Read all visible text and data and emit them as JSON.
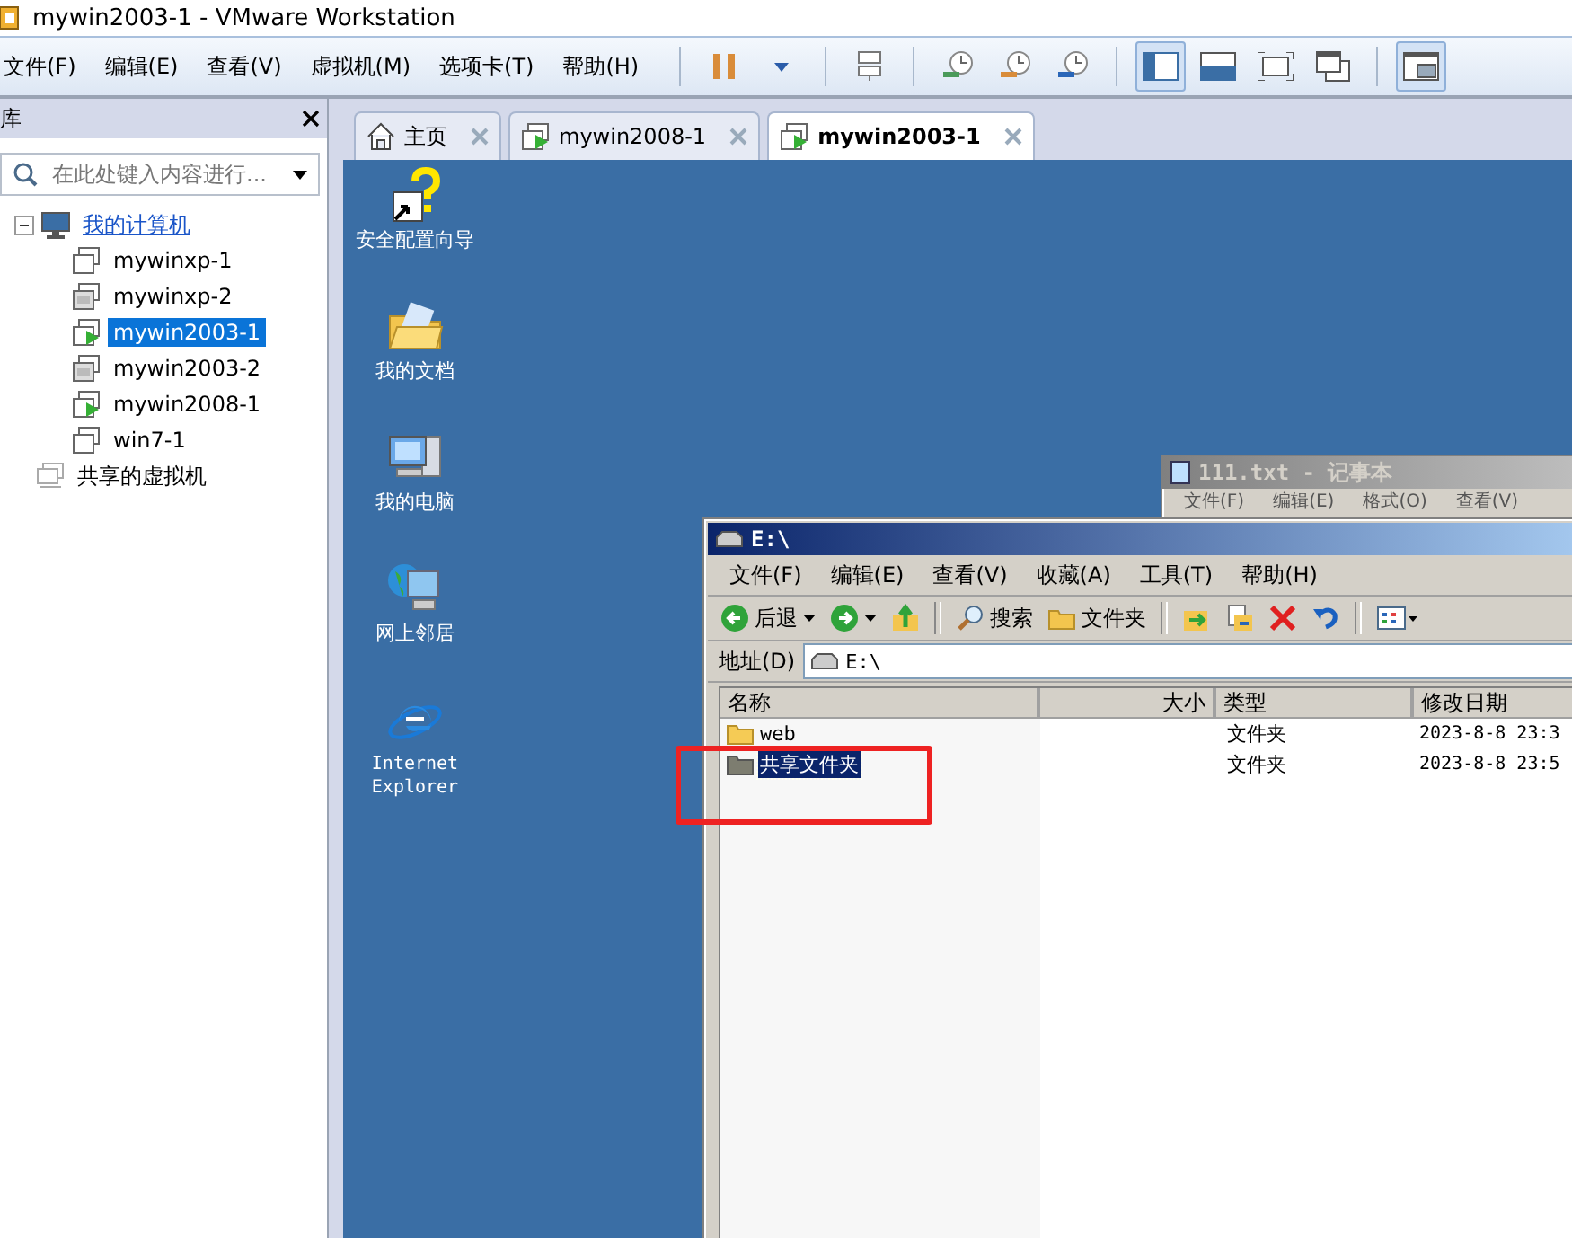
{
  "window": {
    "title": "mywin2003-1 - VMware Workstation"
  },
  "menu": [
    {
      "label": "文件(F)"
    },
    {
      "label": "编辑(E)"
    },
    {
      "label": "查看(V)"
    },
    {
      "label": "虚拟机(M)"
    },
    {
      "label": "选项卡(T)"
    },
    {
      "label": "帮助(H)"
    }
  ],
  "toolbar": [
    {
      "kind": "pause",
      "selected": false
    },
    {
      "kind": "caret",
      "selected": false
    },
    {
      "kind": "sep"
    },
    {
      "kind": "send",
      "selected": false
    },
    {
      "kind": "sep"
    },
    {
      "kind": "snap-take",
      "selected": false
    },
    {
      "kind": "snap-revert",
      "selected": false
    },
    {
      "kind": "snap-manage",
      "selected": false
    },
    {
      "kind": "sep"
    },
    {
      "kind": "view-library",
      "selected": true
    },
    {
      "kind": "view-thumb",
      "selected": false
    },
    {
      "kind": "view-full",
      "selected": false
    },
    {
      "kind": "view-unity",
      "selected": false
    },
    {
      "kind": "sep"
    },
    {
      "kind": "view-console",
      "selected": true
    }
  ],
  "sidebar": {
    "title": "库",
    "search": {
      "placeholder": "在此处键入内容进行..."
    },
    "tree": [
      {
        "label": "我的计算机",
        "kind": "computer",
        "expanded": true,
        "children": [
          {
            "label": "mywinxp-1",
            "running": false,
            "suspended": false,
            "selected": false
          },
          {
            "label": "mywinxp-2",
            "running": false,
            "suspended": true,
            "selected": false
          },
          {
            "label": "mywin2003-1",
            "running": true,
            "suspended": false,
            "selected": true
          },
          {
            "label": "mywin2003-2",
            "running": false,
            "suspended": true,
            "selected": false
          },
          {
            "label": "mywin2008-1",
            "running": true,
            "suspended": false,
            "selected": false
          },
          {
            "label": "win7-1",
            "running": false,
            "suspended": false,
            "selected": false
          }
        ]
      },
      {
        "label": "共享的虚拟机",
        "kind": "shared"
      }
    ]
  },
  "tabs": [
    {
      "label": "主页",
      "kind": "home",
      "selected": false
    },
    {
      "label": "mywin2008-1",
      "kind": "vm",
      "selected": false
    },
    {
      "label": "mywin2003-1",
      "kind": "vm",
      "selected": true
    }
  ],
  "desktop": {
    "icons": [
      {
        "label": "安全配置向导",
        "kind": "wizard"
      },
      {
        "label": "我的文档",
        "kind": "documents"
      },
      {
        "label": "我的电脑",
        "kind": "computer"
      },
      {
        "label": "网上邻居",
        "kind": "network"
      },
      {
        "label": "Internet Explorer",
        "kind": "ie"
      }
    ]
  },
  "notepad": {
    "title": "111.txt - 记事本",
    "menu": [
      "文件(F)",
      "编辑(E)",
      "格式(O)",
      "查看(V)"
    ]
  },
  "explorer": {
    "title": "E:\\",
    "menu": [
      "文件(F)",
      "编辑(E)",
      "查看(V)",
      "收藏(A)",
      "工具(T)",
      "帮助(H)"
    ],
    "toolbar": [
      {
        "kind": "back",
        "label": "后退"
      },
      {
        "kind": "forward"
      },
      {
        "kind": "up"
      },
      {
        "kind": "sep"
      },
      {
        "kind": "search",
        "label": "搜索"
      },
      {
        "kind": "folders",
        "label": "文件夹"
      },
      {
        "kind": "sep"
      },
      {
        "kind": "move"
      },
      {
        "kind": "copy"
      },
      {
        "kind": "delete"
      },
      {
        "kind": "undo"
      },
      {
        "kind": "sep"
      },
      {
        "kind": "views"
      }
    ],
    "address": {
      "label": "地址(D)",
      "value": "E:\\"
    },
    "columns": [
      "名称",
      "大小",
      "类型",
      "修改日期"
    ],
    "rows": [
      {
        "name": "web",
        "size": "",
        "type": "文件夹",
        "date": "2023-8-8 23:3",
        "selected": false,
        "kind": "folder"
      },
      {
        "name": "共享文件夹",
        "size": "",
        "type": "文件夹",
        "date": "2023-8-8 23:5",
        "selected": true,
        "kind": "shared-folder"
      }
    ]
  },
  "annotation": {
    "kind": "highlight",
    "color": "#ee2222"
  }
}
